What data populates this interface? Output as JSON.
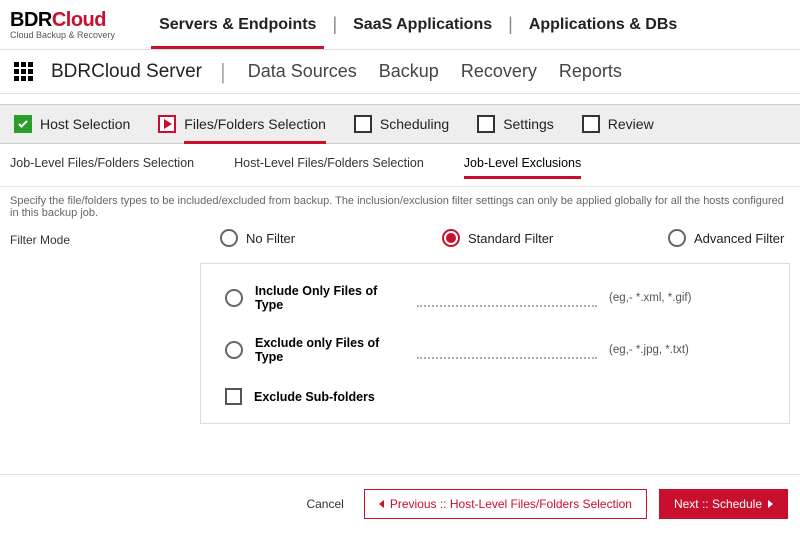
{
  "brand": {
    "b": "BDR",
    "r": "Cloud",
    "sub": "Cloud Backup & Recovery"
  },
  "main_nav": {
    "item0": "Servers & Endpoints",
    "item1": "SaaS Applications",
    "item2": "Applications & DBs"
  },
  "sub": {
    "title": "BDRCloud Server",
    "nav0": "Data Sources",
    "nav1": "Backup",
    "nav2": "Recovery",
    "nav3": "Reports"
  },
  "wizard": {
    "s0": "Host Selection",
    "s1": "Files/Folders Selection",
    "s2": "Scheduling",
    "s3": "Settings",
    "s4": "Review"
  },
  "tabs": {
    "t0": "Job-Level Files/Folders Selection",
    "t1": "Host-Level Files/Folders Selection",
    "t2": "Job-Level Exclusions"
  },
  "desc": "Specify the file/folders types to be included/excluded from backup. The inclusion/exclusion filter settings can only be applied globally for all the hosts configured in this backup job.",
  "filter": {
    "label": "Filter Mode",
    "opt0": "No Filter",
    "opt1": "Standard Filter",
    "opt2": "Advanced Filter",
    "include_label": "Include Only Files of Type",
    "include_hint": "(eg,- *.xml, *.gif)",
    "exclude_label": "Exclude only Files of Type",
    "exclude_hint": "(eg,- *.jpg, *.txt)",
    "subfolders": "Exclude Sub-folders"
  },
  "footer": {
    "cancel": "Cancel",
    "prev": "Previous :: Host-Level Files/Folders Selection",
    "next": "Next :: Schedule"
  }
}
